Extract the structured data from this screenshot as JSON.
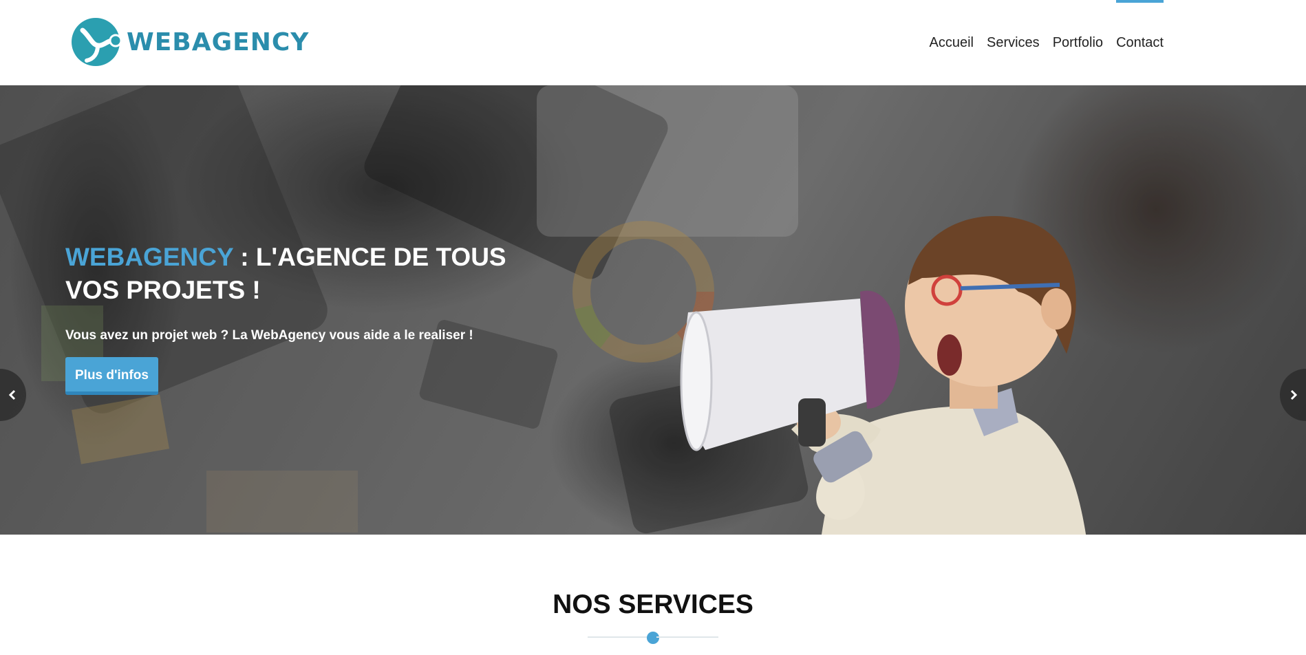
{
  "header": {
    "logo_text": "WEBAGENCY",
    "nav": [
      {
        "label": "Accueil"
      },
      {
        "label": "Services"
      },
      {
        "label": "Portfolio"
      },
      {
        "label": "Contact"
      }
    ],
    "active_nav": "Contact"
  },
  "hero": {
    "title_brand": "WEBAGENCY",
    "title_rest": " : L'AGENCE DE TOUS VOS PROJETS !",
    "subtitle": "Vous avez un projet web ? La WebAgency vous aide a le realiser !",
    "button_label": "Plus d'infos",
    "prev_icon": "chevron-left-icon",
    "next_icon": "chevron-right-icon"
  },
  "services": {
    "title": "NOS SERVICES"
  },
  "colors": {
    "accent": "#4aa4d6",
    "logo": "#2b8dac",
    "button_border": "#2f86bb"
  }
}
